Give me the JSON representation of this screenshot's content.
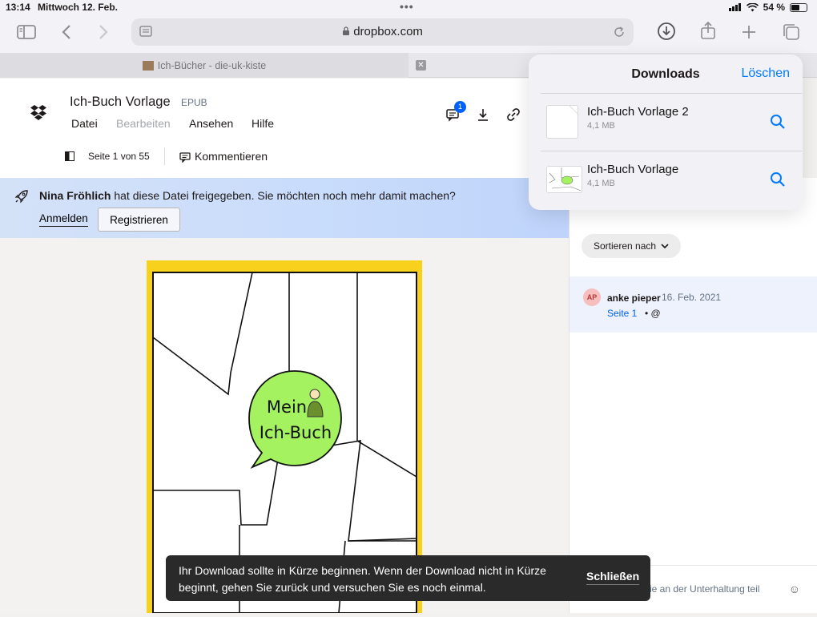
{
  "status_bar": {
    "time": "13:14",
    "date": "Mittwoch 12. Feb.",
    "dots": "•••",
    "battery": "54 %"
  },
  "browser": {
    "url": "dropbox.com"
  },
  "tab": {
    "title": "Ich-Bücher - die-uk-kiste",
    "close": "✕"
  },
  "document": {
    "title": "Ich-Buch Vorlage",
    "ext": "EPUB",
    "menu": [
      "Datei",
      "Bearbeiten",
      "Ansehen",
      "Hilfe"
    ],
    "comment_badge": "1",
    "page_info": "Seite 1 von 55",
    "comment_button": "Kommentieren"
  },
  "banner": {
    "name": "Nina Fröhlich",
    "message": " hat diese Datei freigegeben. Sie möchten noch mehr damit machen?",
    "login": "Anmelden",
    "register": "Registrieren"
  },
  "book": {
    "line1": "Mein",
    "line2": "Ich-Buch"
  },
  "side_panel": {
    "sort_label": "Sortieren nach",
    "comment": {
      "avatar": "AP",
      "author": "anke pieper",
      "date": "16. Feb. 2021",
      "page": "Seite 1",
      "sep": " • @"
    },
    "composer_placeholder": "ie an der Unterhaltung teil",
    "emoji": "☺"
  },
  "downloads": {
    "title": "Downloads",
    "clear": "Löschen",
    "items": [
      {
        "name": "Ich-Buch Vorlage 2",
        "size": "4,1 MB"
      },
      {
        "name": "Ich-Buch Vorlage",
        "size": "4,1 MB"
      }
    ]
  },
  "toast": {
    "text": "Ihr Download sollte in Kürze beginnen. Wenn der Download nicht in Kürze beginnt, gehen Sie zurück und versuchen Sie es noch einmal.",
    "close": "Schließen"
  },
  "colors": {
    "accent_blue": "#0061fe",
    "ios_blue": "#007aff",
    "book_yellow": "#f8d11c",
    "bubble_green": "#9bf24c"
  }
}
